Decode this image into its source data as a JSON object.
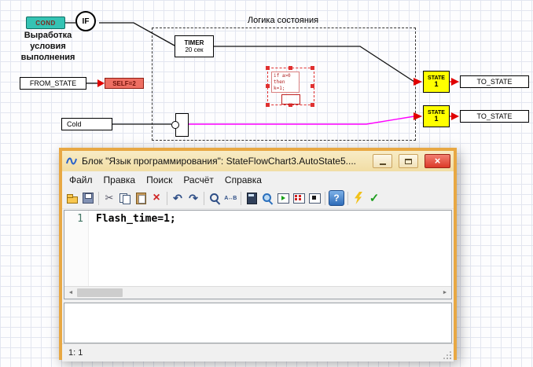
{
  "diagram": {
    "cond_label": "COND",
    "if_label": "IF",
    "caption_lines": [
      "Выработка",
      "условия",
      "выполнения"
    ],
    "group_title": "Логика состояния",
    "timer_title": "TIMER",
    "timer_sub": "20 сек",
    "code_block_lines": [
      "if a>0",
      "then",
      "k=1;"
    ],
    "from_state_label": "FROM_STATE",
    "self_label": "SELF=2",
    "cold_label": "Cold",
    "state1": {
      "line1": "STATE",
      "line2": "1"
    },
    "state2": {
      "line1": "STATE",
      "line2": "1"
    },
    "to_state1_label": "TO_STATE",
    "to_state2_label": "TO_STATE",
    "colors": {
      "state_fill": "#ffff00",
      "cond_fill": "#35c3b4",
      "self_fill": "#ee6f63",
      "wire": "#000000",
      "wire_active": "#ff00ff",
      "port_arrow": "#e00000",
      "selection": "#e03030",
      "window_frame": "#e8a843",
      "close_button": "#dc3a28"
    }
  },
  "window": {
    "title": "Блок \"Язык программирования\": StateFlowChart3.AutoState5....",
    "menu": [
      "Файл",
      "Правка",
      "Поиск",
      "Расчёт",
      "Справка"
    ],
    "toolbar": [
      "open",
      "save",
      "|",
      "cut",
      "copy",
      "paste",
      "delete",
      "|",
      "undo",
      "redo",
      "|",
      "find",
      "replace",
      "|",
      "calculator",
      "zoom",
      "run",
      "matrix",
      "stop",
      "|",
      "help",
      "|",
      "compile",
      "apply"
    ],
    "editor": {
      "line_number": "1",
      "code": "Flash_time=1;"
    },
    "scrollbar": {
      "left_glyph": "◄",
      "right_glyph": "►"
    },
    "status": "1: 1"
  }
}
